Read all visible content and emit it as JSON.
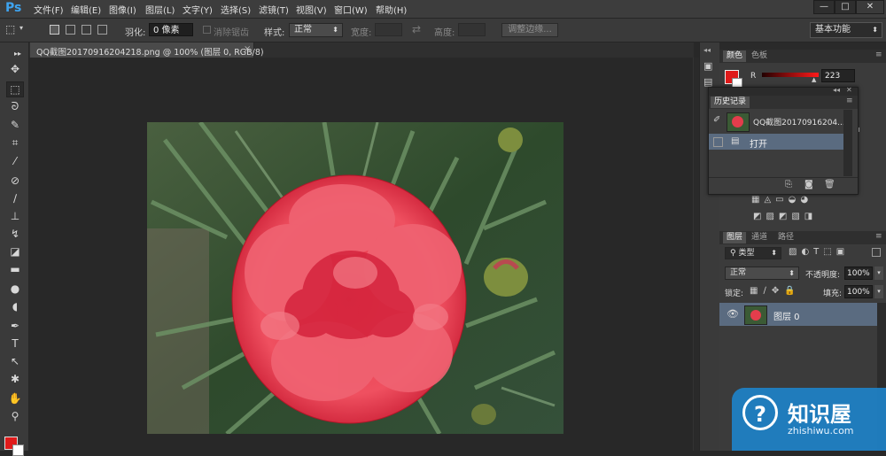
{
  "app": {
    "logo": "Ps",
    "menu": [
      "文件(F)",
      "编辑(E)",
      "图像(I)",
      "图层(L)",
      "文字(Y)",
      "选择(S)",
      "滤镜(T)",
      "视图(V)",
      "窗口(W)",
      "帮助(H)"
    ],
    "window_controls": [
      "—",
      "□",
      "✕"
    ]
  },
  "options": {
    "feather_label": "羽化:",
    "feather_value": "0 像素",
    "antialias_label": "消除锯齿",
    "style_label": "样式:",
    "style_value": "正常",
    "width_label": "宽度:",
    "height_label": "高度:",
    "refine_edge": "调整边缘...",
    "workspace": "基本功能"
  },
  "document": {
    "tab_title": "QQ截图20170916204218.png @ 100% (图层 0, RGB/8)",
    "close": "×"
  },
  "color_panel": {
    "tabs": [
      "颜色",
      "色板"
    ],
    "channel": "R",
    "value": "223",
    "fg_color": "#df1a1a"
  },
  "history_panel": {
    "title": "历史记录",
    "snapshot_label": "QQ截图20170916204...",
    "items": [
      "打开"
    ]
  },
  "layers_panel": {
    "tabs": [
      "图层",
      "通道",
      "路径"
    ],
    "filter": "类型",
    "blend_mode": "正常",
    "opacity_label": "不透明度:",
    "opacity_value": "100%",
    "lock_label": "锁定:",
    "fill_label": "填充:",
    "fill_value": "100%",
    "layers": [
      {
        "name": "图层 0"
      }
    ]
  },
  "watermark": {
    "title": "知识屋",
    "url": "zhishiwu.com"
  },
  "colors": {
    "accent": "#3ea4f0",
    "selected_row": "#5a6b80",
    "foreground_swatch": "#df1a1a"
  }
}
